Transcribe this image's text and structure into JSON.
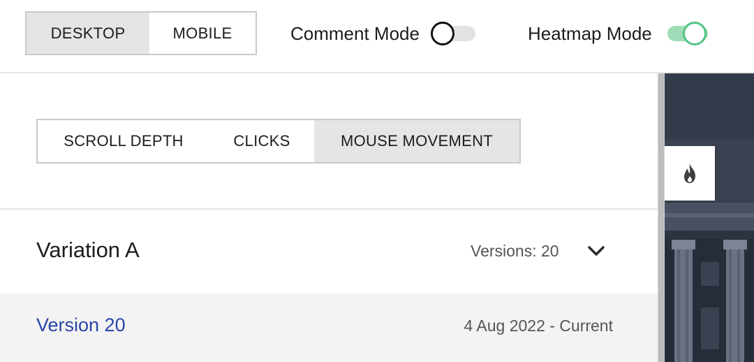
{
  "device_toggle": {
    "desktop_label": "DESKTOP",
    "mobile_label": "MOBILE",
    "selected": "desktop"
  },
  "modes": {
    "comment": {
      "label": "Comment Mode",
      "enabled": false
    },
    "heatmap": {
      "label": "Heatmap Mode",
      "enabled": true
    }
  },
  "heatmap_tabs": {
    "scroll_label": "SCROLL DEPTH",
    "clicks_label": "CLICKS",
    "mouse_label": "MOUSE MOVEMENT",
    "selected": "mouse"
  },
  "variation": {
    "title": "Variation A",
    "versions_label": "Versions: 20"
  },
  "version_item": {
    "name": "Version 20",
    "date": "4 Aug 2022 - Current"
  },
  "preview": {
    "heatmap_button_icon": "flame-icon"
  },
  "colors": {
    "toggle_on": "#52c283",
    "toggle_on_track": "#9fdcb8",
    "link_blue": "#2a45a8",
    "selected_bg": "#e5e5e5"
  }
}
